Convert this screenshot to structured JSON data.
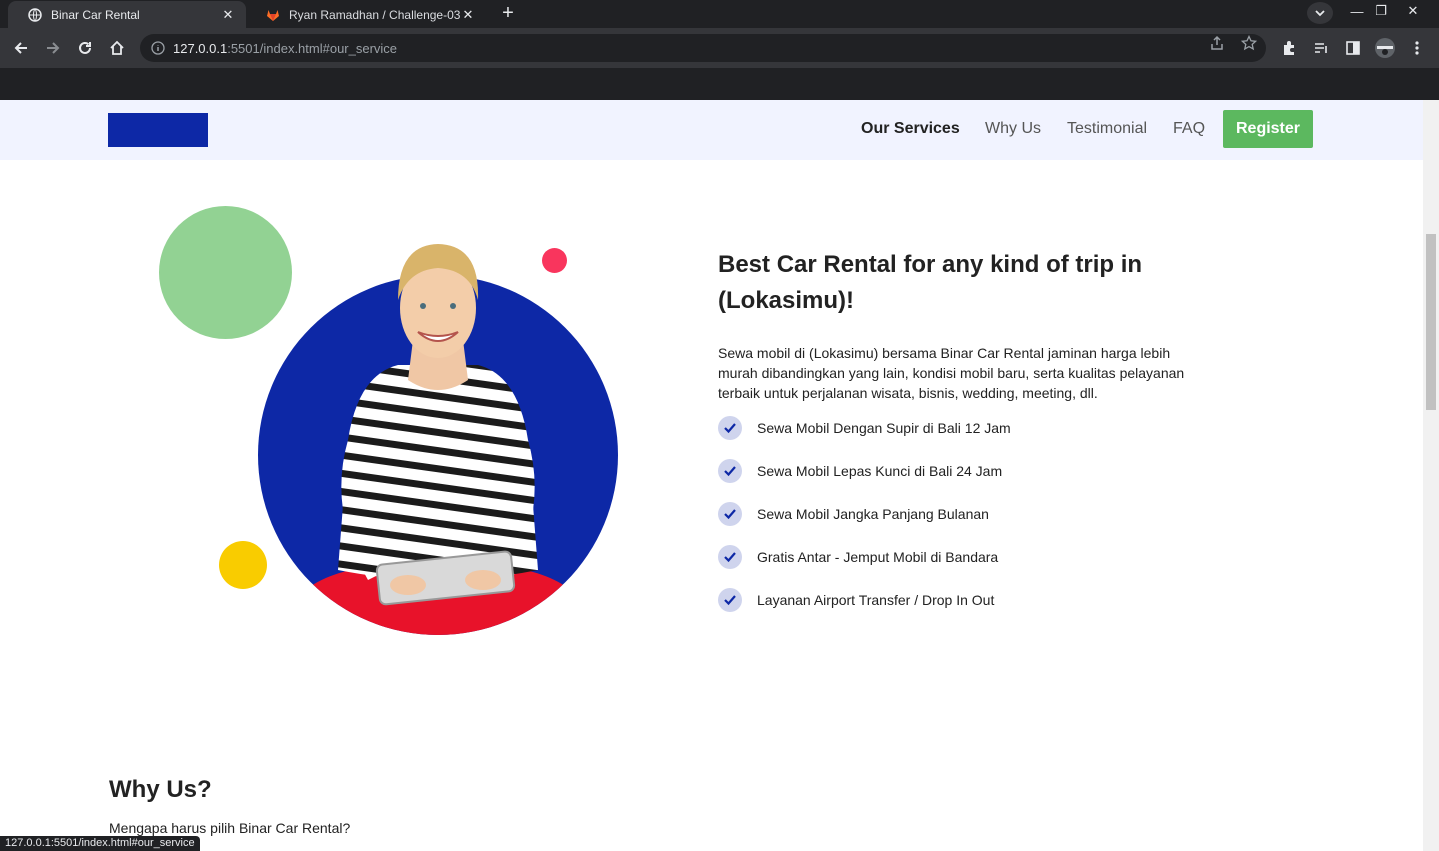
{
  "browser": {
    "tabs": [
      {
        "title": "Binar Car Rental",
        "active": true,
        "icon": "globe-icon"
      },
      {
        "title": "Ryan Ramadhan / Challenge-03 ·",
        "active": false,
        "icon": "gitlab-icon"
      }
    ],
    "url_host": "127.0.0.1",
    "url_rest": ":5501/index.html#our_service",
    "status_text": "127.0.0.1:5501/index.html#our_service"
  },
  "nav": {
    "links": [
      "Our Services",
      "Why Us",
      "Testimonial",
      "FAQ"
    ],
    "register_label": "Register",
    "logo_color": "#0d28a6"
  },
  "hero": {
    "title": "Best Car Rental for any kind of trip in (Lokasimu)!",
    "description": "Sewa mobil di (Lokasimu) bersama Binar Car Rental jaminan harga lebih murah dibandingkan yang lain, kondisi mobil baru, serta kualitas pelayanan terbaik untuk perjalanan wisata, bisnis, wedding, meeting, dll.",
    "features": [
      "Sewa Mobil Dengan Supir di Bali 12 Jam",
      "Sewa Mobil Lepas Kunci di Bali 24 Jam",
      "Sewa Mobil Jangka Panjang Bulanan",
      "Gratis Antar - Jemput Mobil di Bandara",
      "Layanan Airport Transfer / Drop In Out"
    ]
  },
  "why": {
    "title": "Why Us?",
    "subtitle": "Mengapa harus pilih Binar Car Rental?"
  },
  "colors": {
    "primary_blue": "#0d28a6",
    "green": "#5cb85f",
    "light_green": "#92d293",
    "pink": "#f9355d",
    "yellow": "#f9cc00",
    "nav_bg": "#f1f3ff"
  }
}
